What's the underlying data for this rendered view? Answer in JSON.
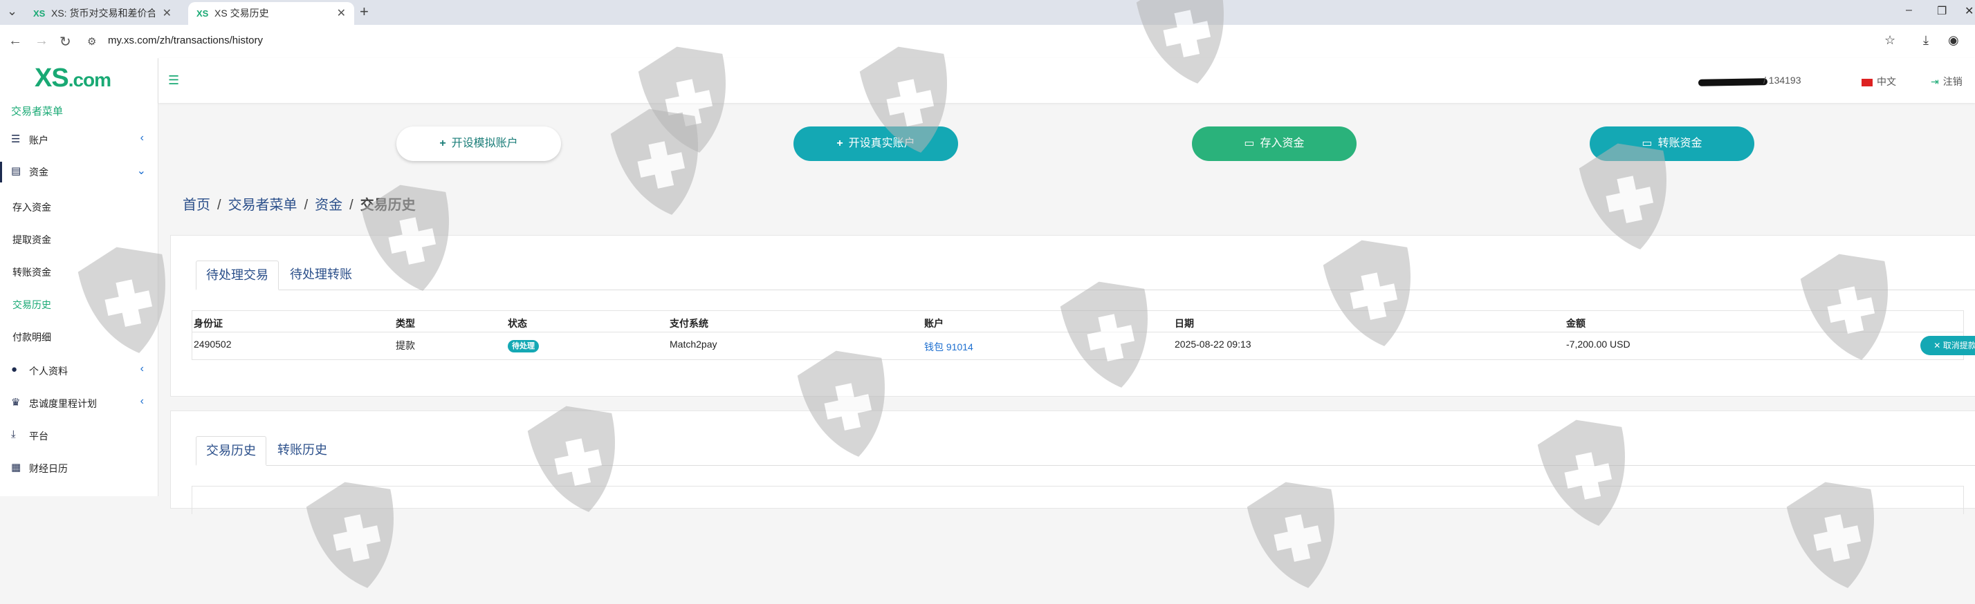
{
  "browser": {
    "tabs": [
      {
        "favicon": "XS",
        "title": "XS: 货币对交易和差价合约经纪商"
      },
      {
        "favicon": "XS",
        "title": "XS 交易历史"
      }
    ],
    "url": "my.xs.com/zh/transactions/history"
  },
  "sidebar": {
    "logo_main": "XS",
    "logo_dom": ".com",
    "menu_title": "交易者菜单",
    "items": [
      {
        "icon": "list-icon",
        "label": "账户"
      },
      {
        "icon": "wallet-icon",
        "label": "资金"
      },
      {
        "icon": "user-icon",
        "label": "个人资料"
      },
      {
        "icon": "trophy-icon",
        "label": "忠诚度里程计划"
      },
      {
        "icon": "download-icon",
        "label": "平台"
      },
      {
        "icon": "calendar-icon",
        "label": "财经日历"
      }
    ],
    "funds_sub": [
      "存入资金",
      "提取资金",
      "转账资金",
      "交易历史",
      "付款明细"
    ]
  },
  "header": {
    "user_id": "/ 134193",
    "language": "中文",
    "logout": "注销"
  },
  "actions": {
    "demo": "开设模拟账户",
    "real": "开设真实账户",
    "deposit": "存入资金",
    "transfer": "转账资金"
  },
  "breadcrumb": [
    "首页",
    "交易者菜单",
    "资金",
    "交易历史"
  ],
  "pending": {
    "tabs": [
      "待处理交易",
      "待处理转账"
    ],
    "columns": [
      "身份证",
      "类型",
      "状态",
      "支付系统",
      "账户",
      "日期",
      "金额"
    ],
    "row": {
      "id": "2490502",
      "type": "提款",
      "status": "待处理",
      "system": "Match2pay",
      "account": "钱包 91014",
      "date": "2025-08-22 09:13",
      "amount": "-7,200.00 USD",
      "cancel": "取消提款"
    }
  },
  "history": {
    "tabs": [
      "交易历史",
      "转账历史"
    ]
  },
  "colors": {
    "brand": "#19a974",
    "teal": "#14a8b4",
    "green": "#2ab27b",
    "link": "#2b4f8a"
  }
}
